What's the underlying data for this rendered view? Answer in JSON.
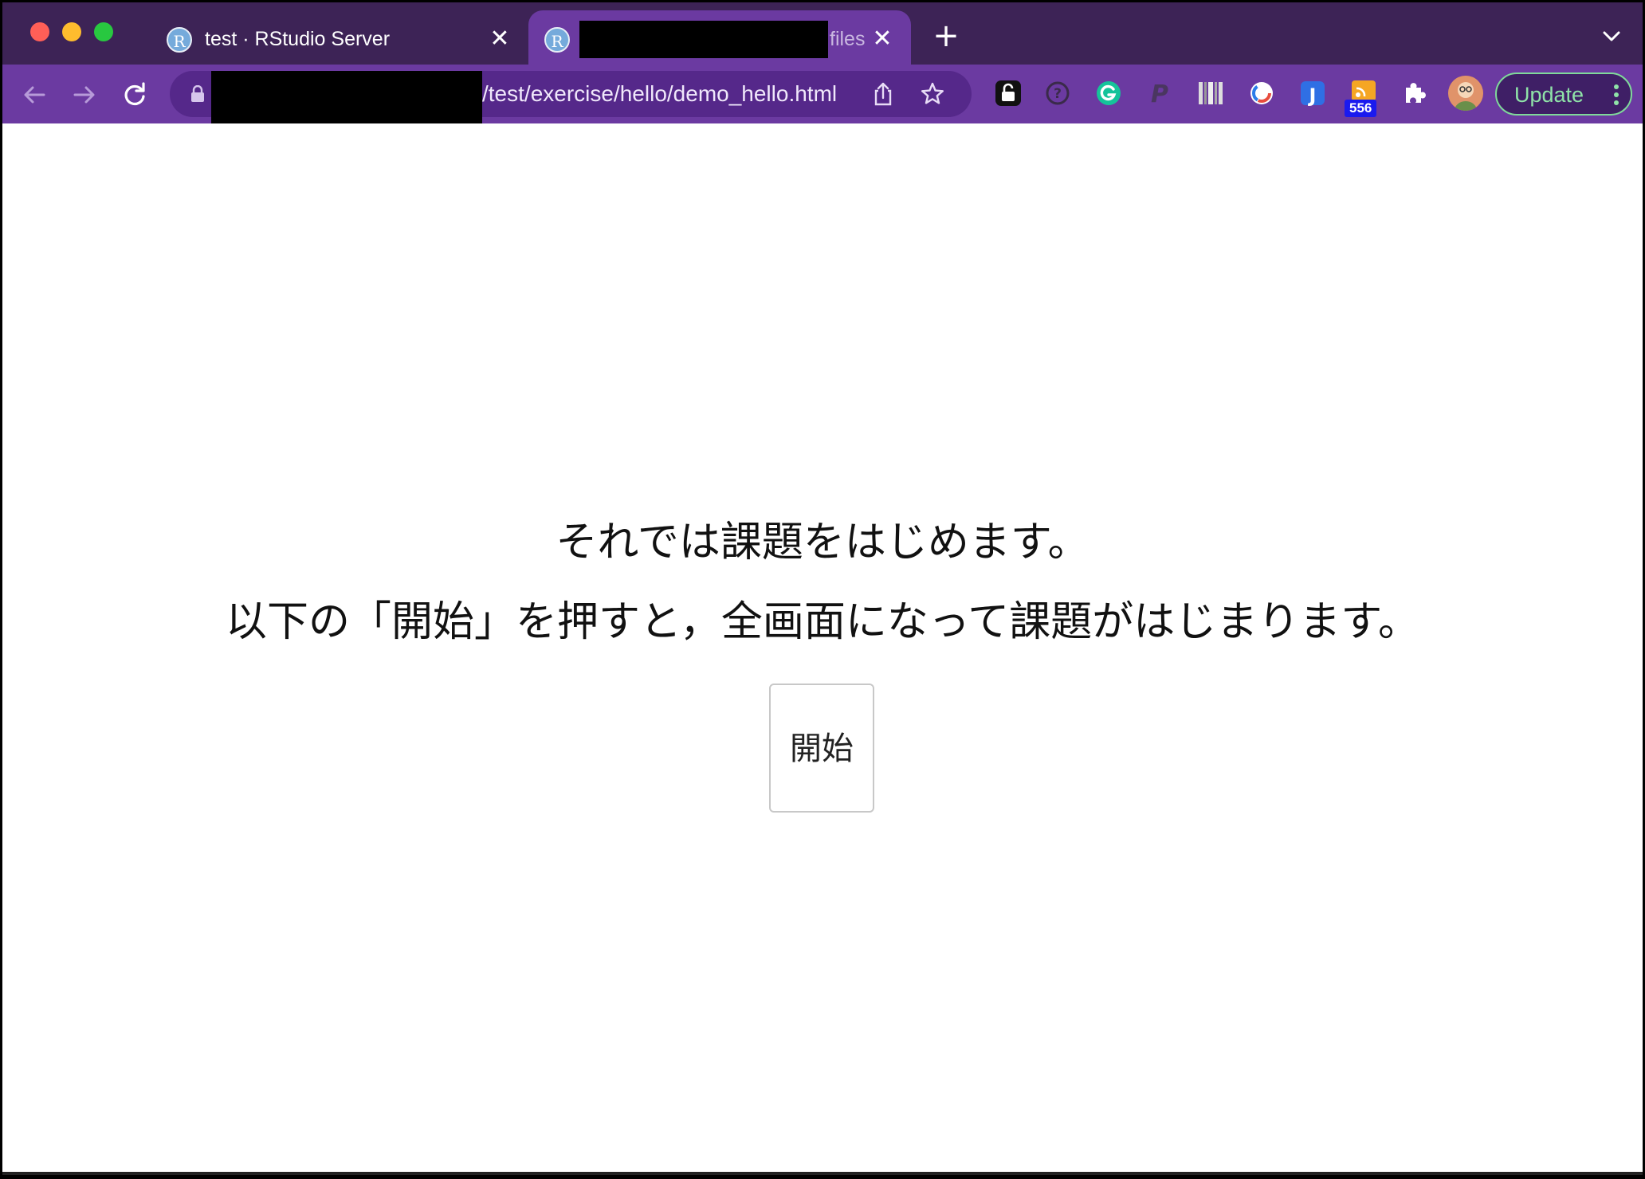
{
  "browser": {
    "tabs": [
      {
        "favicon": "R",
        "title": "test · RStudio Server",
        "active": false
      },
      {
        "favicon": "R",
        "title": "files",
        "active": true
      }
    ],
    "address_bar": {
      "url_visible": "/test/exercise/hello/demo_hello.html"
    },
    "extensions": [
      {
        "icon": "lock-extension-icon"
      },
      {
        "icon": "question-circle-extension-icon"
      },
      {
        "icon": "grammarly-icon"
      },
      {
        "icon": "paypal-icon"
      },
      {
        "icon": "barcode-extension-icon"
      },
      {
        "icon": "circle-extension-icon"
      },
      {
        "icon": "j-extension-icon"
      },
      {
        "icon": "rss-extension-icon",
        "badge": "556"
      },
      {
        "icon": "puzzle-piece-icon"
      }
    ],
    "update_button": "Update"
  },
  "page": {
    "line1": "それでは課題をはじめます。",
    "line2": "以下の「開始」を押すと，全画面になって課題がはじまります。",
    "start_button": "開始"
  },
  "colors": {
    "tab_strip": "#3d2356",
    "toolbar": "#6b3aa1",
    "omnibox": "#55288a",
    "update_accent": "#8fe3a8"
  }
}
